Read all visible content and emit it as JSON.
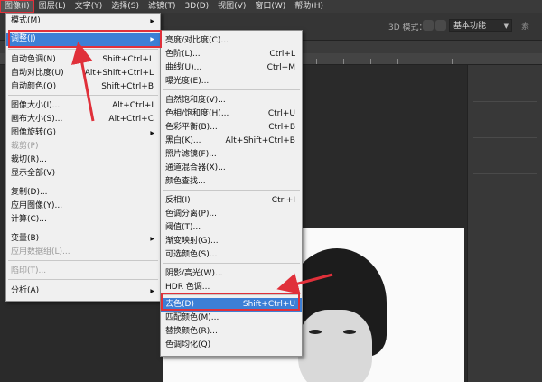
{
  "menubar": {
    "items": [
      "图像(I)",
      "图层(L)",
      "文字(Y)",
      "选择(S)",
      "滤镜(T)",
      "3D(D)",
      "视图(V)",
      "窗口(W)",
      "帮助(H)"
    ]
  },
  "optionsbar": {
    "mode_label": "3D 模式：",
    "workspace": "基本功能",
    "right_text": "素"
  },
  "image_menu": {
    "items": [
      {
        "label": "模式(M)",
        "shortcut": "",
        "submenu": true,
        "disabled": false
      },
      {
        "label": "调整(J)",
        "shortcut": "",
        "submenu": true,
        "disabled": false,
        "highlighted": true
      },
      {
        "label": "自动色调(N)",
        "shortcut": "Shift+Ctrl+L",
        "disabled": false
      },
      {
        "label": "自动对比度(U)",
        "shortcut": "Alt+Shift+Ctrl+L",
        "disabled": false
      },
      {
        "label": "自动颜色(O)",
        "shortcut": "Shift+Ctrl+B",
        "disabled": false
      },
      {
        "label": "图像大小(I)...",
        "shortcut": "Alt+Ctrl+I",
        "disabled": false
      },
      {
        "label": "画布大小(S)...",
        "shortcut": "Alt+Ctrl+C",
        "disabled": false
      },
      {
        "label": "图像旋转(G)",
        "shortcut": "",
        "submenu": true,
        "disabled": false
      },
      {
        "label": "裁剪(P)",
        "shortcut": "",
        "disabled": true
      },
      {
        "label": "裁切(R)...",
        "shortcut": "",
        "disabled": false
      },
      {
        "label": "显示全部(V)",
        "shortcut": "",
        "disabled": false
      },
      {
        "label": "复制(D)...",
        "shortcut": "",
        "disabled": false
      },
      {
        "label": "应用图像(Y)...",
        "shortcut": "",
        "disabled": false
      },
      {
        "label": "计算(C)...",
        "shortcut": "",
        "disabled": false
      },
      {
        "label": "变量(B)",
        "shortcut": "",
        "submenu": true,
        "disabled": false
      },
      {
        "label": "应用数据组(L)...",
        "shortcut": "",
        "disabled": true
      },
      {
        "label": "陷印(T)...",
        "shortcut": "",
        "disabled": true
      },
      {
        "label": "分析(A)",
        "shortcut": "",
        "submenu": true,
        "disabled": false
      }
    ]
  },
  "adjust_menu": {
    "items": [
      {
        "label": "亮度/对比度(C)...",
        "shortcut": "",
        "disabled": false
      },
      {
        "label": "色阶(L)...",
        "shortcut": "Ctrl+L",
        "disabled": false
      },
      {
        "label": "曲线(U)...",
        "shortcut": "Ctrl+M",
        "disabled": false
      },
      {
        "label": "曝光度(E)...",
        "shortcut": "",
        "disabled": false
      },
      {
        "label": "自然饱和度(V)...",
        "shortcut": "",
        "disabled": false
      },
      {
        "label": "色相/饱和度(H)...",
        "shortcut": "Ctrl+U",
        "disabled": false
      },
      {
        "label": "色彩平衡(B)...",
        "shortcut": "Ctrl+B",
        "disabled": false
      },
      {
        "label": "黑白(K)...",
        "shortcut": "Alt+Shift+Ctrl+B",
        "disabled": false
      },
      {
        "label": "照片滤镜(F)...",
        "shortcut": "",
        "disabled": false
      },
      {
        "label": "通道混合器(X)...",
        "shortcut": "",
        "disabled": false
      },
      {
        "label": "颜色查找...",
        "shortcut": "",
        "disabled": false
      },
      {
        "label": "反相(I)",
        "shortcut": "Ctrl+I",
        "disabled": false
      },
      {
        "label": "色调分离(P)...",
        "shortcut": "",
        "disabled": false
      },
      {
        "label": "阈值(T)...",
        "shortcut": "",
        "disabled": false
      },
      {
        "label": "渐变映射(G)...",
        "shortcut": "",
        "disabled": false
      },
      {
        "label": "可选颜色(S)...",
        "shortcut": "",
        "disabled": false
      },
      {
        "label": "阴影/高光(W)...",
        "shortcut": "",
        "disabled": false
      },
      {
        "label": "HDR 色调...",
        "shortcut": "",
        "disabled": false
      },
      {
        "label": "去色(D)",
        "shortcut": "Shift+Ctrl+U",
        "disabled": false,
        "highlighted": true
      },
      {
        "label": "匹配颜色(M)...",
        "shortcut": "",
        "disabled": false
      },
      {
        "label": "替换颜色(R)...",
        "shortcut": "",
        "disabled": false
      },
      {
        "label": "色调均化(Q)",
        "shortcut": "",
        "disabled": false
      }
    ]
  },
  "colors": {
    "highlight": "#3c7fd6",
    "annotation_red": "#e0303a",
    "menu_bg": "#f0f0f0"
  }
}
